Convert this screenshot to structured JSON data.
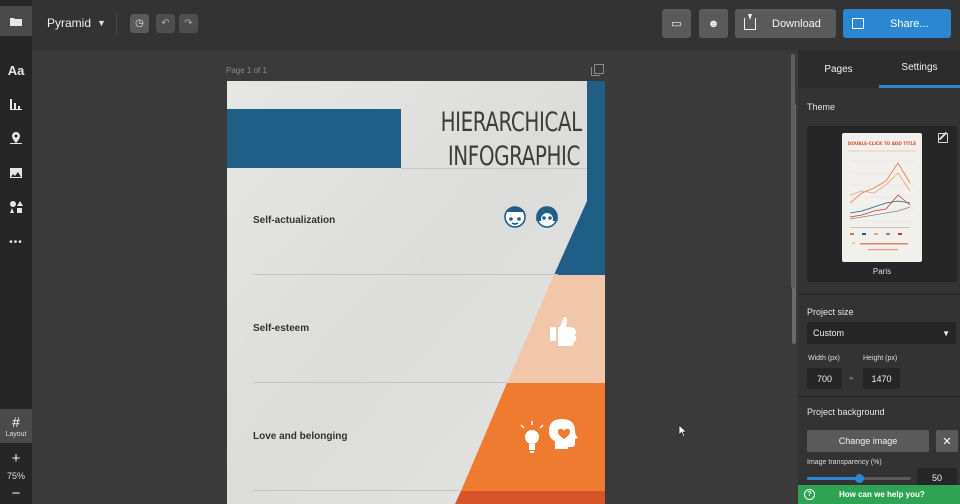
{
  "app": {
    "project_name": "Pyramid"
  },
  "rail": {
    "layout_label": "Layout",
    "zoom_plus": "+",
    "zoom_level": "75%",
    "zoom_minus": "−",
    "text_tool": "Aa",
    "more": "•••"
  },
  "topbar": {
    "download_label": "Download",
    "share_label": "Share..."
  },
  "canvas": {
    "page_label": "Page 1 of 1"
  },
  "infographic": {
    "title_line1": "HIERARCHICAL",
    "title_line2": "INFOGRAPHIC",
    "rows": [
      {
        "label": "Self-actualization",
        "color": "#1f5e86"
      },
      {
        "label": "Self-esteem",
        "color": "#f2c7a9"
      },
      {
        "label": "Love and belonging",
        "color": "#ee7b30"
      }
    ],
    "colors": {
      "blue": "#1f5e86",
      "peach": "#f2c7a9",
      "orange": "#ee7b30",
      "red": "#d9532a"
    }
  },
  "panel": {
    "tabs": [
      {
        "label": "Pages"
      },
      {
        "label": "Settings"
      }
    ],
    "active_tab": "Settings",
    "theme_heading": "Theme",
    "theme_name": "Paris",
    "theme_thumb_title": "DOUBLE-CLICK TO ADD TITLE",
    "project_size_heading": "Project size",
    "project_size_value": "Custom",
    "width_label": "Width (px)",
    "height_label": "Height (px)",
    "width_value": "700",
    "height_value": "1470",
    "background_heading": "Project background",
    "change_image_label": "Change image",
    "close_label": "✕",
    "transparency_label": "Image transparency (%)",
    "transparency_value": "50",
    "help_label": "How can we help you?",
    "accent": "#2b87d1"
  }
}
